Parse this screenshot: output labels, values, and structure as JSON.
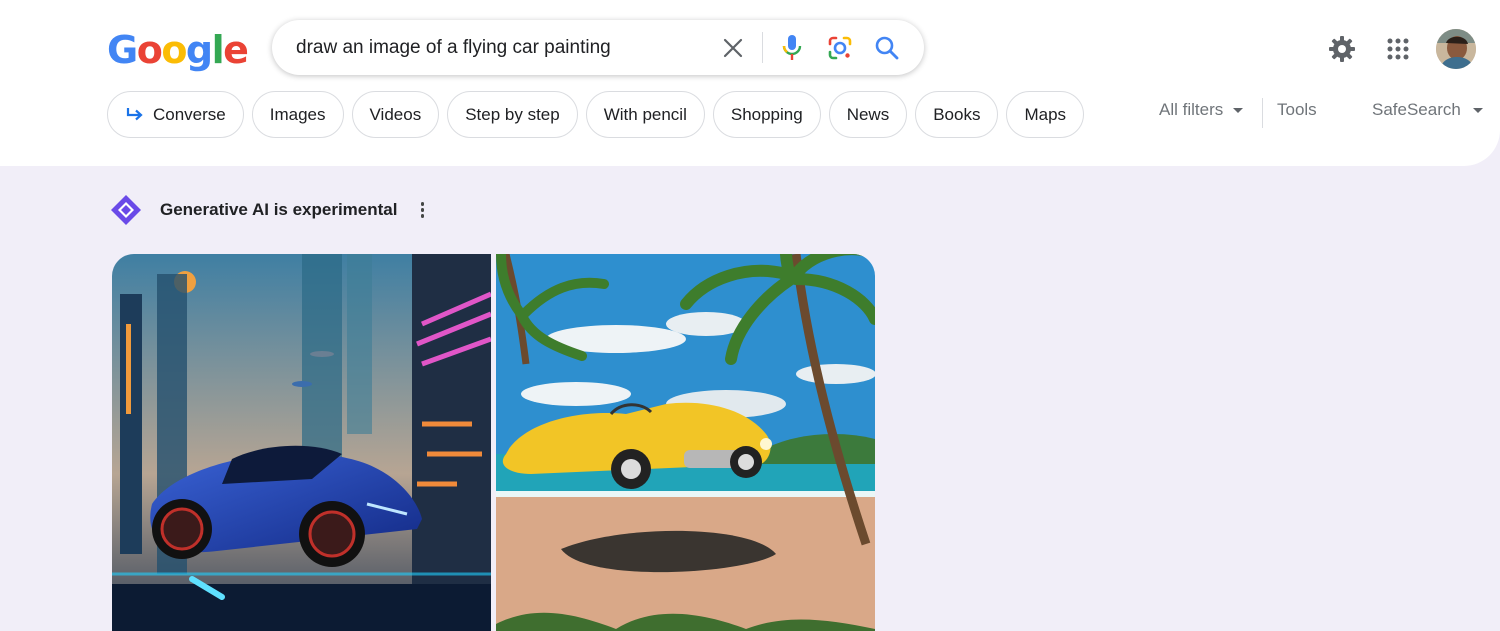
{
  "logo": {
    "letters": [
      "G",
      "o",
      "o",
      "g",
      "l",
      "e"
    ],
    "colors": [
      "#4285F4",
      "#EA4335",
      "#FBBC05",
      "#4285F4",
      "#34A853",
      "#EA4335"
    ]
  },
  "search": {
    "query": "draw an image of a flying car painting"
  },
  "header_icons": [
    "settings-gear-icon",
    "apps-grid-icon",
    "avatar"
  ],
  "chips": [
    {
      "label": "Converse",
      "icon": "arrow-return-icon"
    },
    {
      "label": "Images"
    },
    {
      "label": "Videos"
    },
    {
      "label": "Step by step"
    },
    {
      "label": "With pencil"
    },
    {
      "label": "Shopping"
    },
    {
      "label": "News"
    },
    {
      "label": "Books"
    },
    {
      "label": "Maps"
    }
  ],
  "tools": {
    "all_filters": "All filters",
    "tools": "Tools",
    "safesearch": "SafeSearch"
  },
  "generative": {
    "label": "Generative AI is experimental"
  },
  "images": [
    {
      "subject": "blue sports car flying through futuristic neon city"
    },
    {
      "subject": "yellow vintage convertible floating above tropical beach with palm trees"
    }
  ],
  "colors": {
    "accent": "#1a73e8",
    "gen_icon": "#6a4ae8"
  }
}
